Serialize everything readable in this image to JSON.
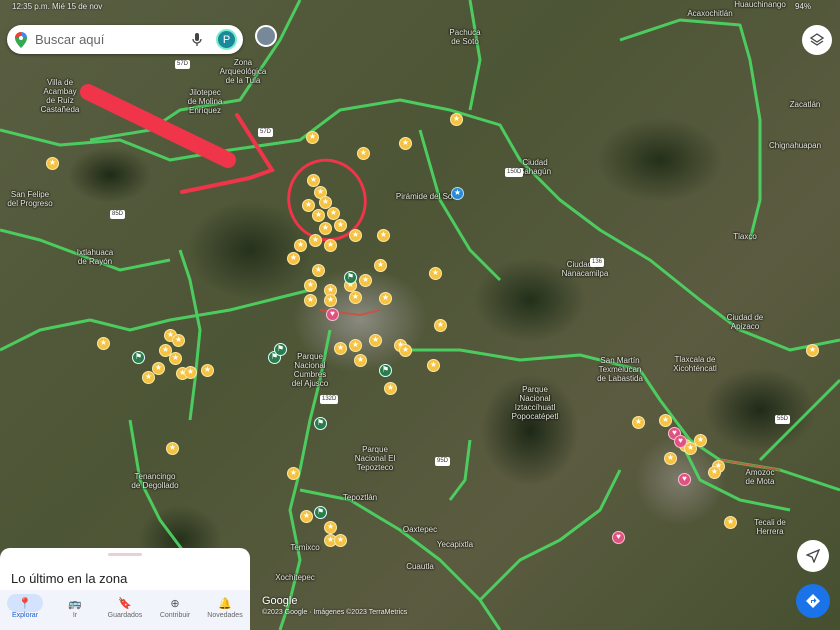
{
  "status_bar": {
    "time": "12:35 p.m.",
    "date": "Mié 15 de nov",
    "battery": "94%"
  },
  "search": {
    "placeholder": "Buscar aquí",
    "avatar_letter": "P"
  },
  "map": {
    "labels": [
      "Villa de Acambay\nde Ruíz\nCastañeda",
      "Jilotepec\nde Molina\nEnríquez",
      "Zona Arqueológica\nde la Tula",
      "San Felipe\ndel Progreso",
      "Ixtlahuaca\nde Rayón",
      "Pirámide del Sol",
      "Ciudad\nSahagún",
      "Chignahuapan",
      "Zacatlán",
      "Acaxochitlán",
      "Huauchinango",
      "Tlaxco",
      "Ciudad de\nNanacamilpa",
      "Ciudad de\nApizaco",
      "San Martín\nTexmelucan\nde Labastida",
      "Tlaxcala de\nXicohténcatl",
      "Parque\nNacional\nIztaccíhuatl\nPopocatépetl",
      "Parque\nNacional\nCumbres\ndel Ajusco",
      "Parque\nNacional El\nTepozteco",
      "Tepoztlán",
      "Oaxtepec",
      "Tenancingo\nde Degollado",
      "Temixco",
      "Yecapixtla",
      "Cuautla",
      "Xochitepec",
      "Amozoc\nde Mota",
      "Tecali de\nHerrera",
      "Pachuca\nde Soto"
    ],
    "route_shields": [
      "57D",
      "57D",
      "85D",
      "150D",
      "136",
      "132D",
      "95D",
      "55D"
    ],
    "annotation_color": "#f0354a",
    "road_color": "#4cd964"
  },
  "attribution": {
    "logo": "Google",
    "copyright": "©2023 Google · Imágenes ©2023 TerraMetrics"
  },
  "panel": {
    "title": "Lo último en la zona"
  },
  "nav": [
    {
      "label": "Explorar",
      "icon": "pin-icon",
      "active": true
    },
    {
      "label": "Ir",
      "icon": "transit-icon"
    },
    {
      "label": "Guardados",
      "icon": "bookmark-icon"
    },
    {
      "label": "Contribuir",
      "icon": "plus-circle-icon"
    },
    {
      "label": "Novedades",
      "icon": "bell-icon"
    }
  ]
}
